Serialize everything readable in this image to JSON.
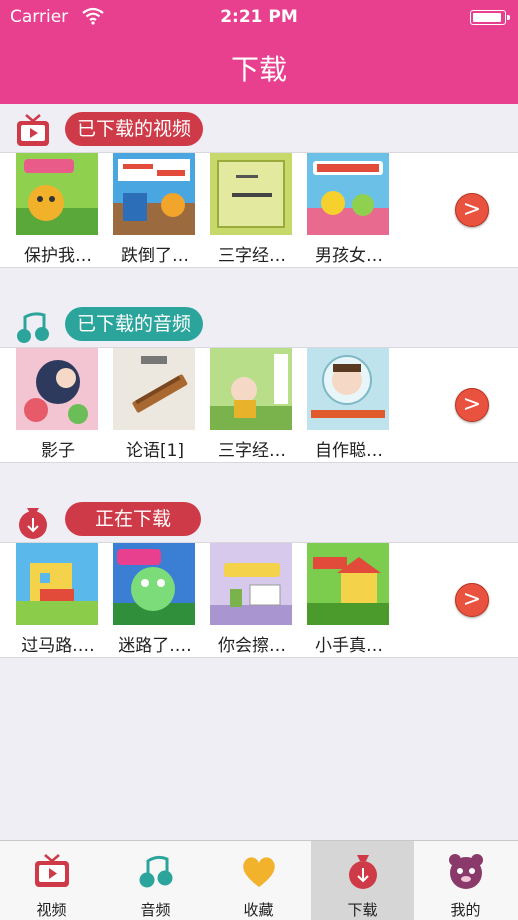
{
  "status_bar": {
    "carrier": "Carrier",
    "time": "2:21 PM"
  },
  "nav": {
    "title": "下载"
  },
  "sections": [
    {
      "title": "已下载的视频",
      "color": "#cf3a48",
      "icon": "tv-icon",
      "more": ">",
      "items": [
        {
          "caption": "保护我…",
          "thumb_color": "#8fd14f"
        },
        {
          "caption": "跌倒了…",
          "thumb_color": "#4aa6e0"
        },
        {
          "caption": "三字经…",
          "thumb_color": "#c7d96b"
        },
        {
          "caption": "男孩女…",
          "thumb_color": "#6bc0e8"
        }
      ]
    },
    {
      "title": "已下载的音频",
      "color": "#2ba59c",
      "icon": "music-note-icon",
      "more": ">",
      "items": [
        {
          "caption": "影子",
          "thumb_color": "#f3c5d2"
        },
        {
          "caption": "论语[1]",
          "thumb_color": "#ece7df"
        },
        {
          "caption": "三字经…",
          "thumb_color": "#b8de8a"
        },
        {
          "caption": "自作聪…",
          "thumb_color": "#bfe3ec"
        }
      ]
    },
    {
      "title": "正在下载",
      "color": "#cf3a48",
      "icon": "download-bag-icon",
      "more": ">",
      "items": [
        {
          "caption": "过马路.…",
          "thumb_color": "#5bb8ea"
        },
        {
          "caption": "迷路了.…",
          "thumb_color": "#3b7fd4"
        },
        {
          "caption": "你会擦…",
          "thumb_color": "#d6c9ec"
        },
        {
          "caption": "小手真…",
          "thumb_color": "#7ccc4e"
        }
      ]
    }
  ],
  "tabs": [
    {
      "label": "视频",
      "icon": "tv-icon",
      "active": false
    },
    {
      "label": "音频",
      "icon": "music-note-icon",
      "active": false
    },
    {
      "label": "收藏",
      "icon": "heart-icon",
      "active": false
    },
    {
      "label": "下载",
      "icon": "download-bag-icon",
      "active": true
    },
    {
      "label": "我的",
      "icon": "bear-face-icon",
      "active": false
    }
  ]
}
